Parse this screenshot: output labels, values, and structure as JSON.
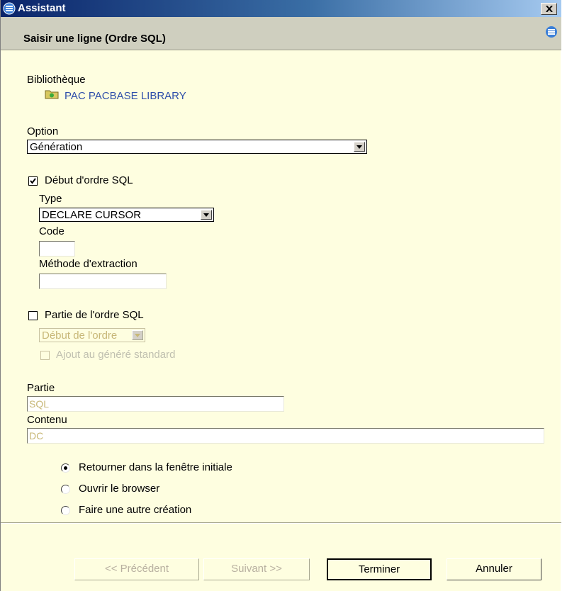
{
  "window": {
    "title": "Assistant"
  },
  "header": {
    "title": "Saisir une ligne (Ordre SQL)"
  },
  "library": {
    "label": "Bibliothèque",
    "name": "PAC PACBASE LIBRARY"
  },
  "option": {
    "label": "Option",
    "value": "Génération"
  },
  "debut": {
    "label": "Début d'ordre SQL",
    "checked": true,
    "type_label": "Type",
    "type_value": "DECLARE CURSOR",
    "code_label": "Code",
    "code_value": "",
    "methode_label": "Méthode d'extraction",
    "methode_value": ""
  },
  "partie_ordre": {
    "label": "Partie de l'ordre SQL",
    "checked": false,
    "combo_value": "Début de l'ordre",
    "ajout_label": "Ajout au généré standard"
  },
  "partie": {
    "label": "Partie",
    "value": "SQL"
  },
  "contenu": {
    "label": "Contenu",
    "value": "DC"
  },
  "radios": [
    {
      "label": "Retourner dans la fenêtre initiale",
      "selected": true
    },
    {
      "label": "Ouvrir le browser",
      "selected": false
    },
    {
      "label": "Faire une autre création",
      "selected": false
    }
  ],
  "buttons": {
    "precedent": "<< Précédent",
    "suivant": "Suivant >>",
    "terminer": "Terminer",
    "annuler": "Annuler"
  },
  "colors": {
    "title_gradient_start": "#0a246a",
    "background": "#fefee0",
    "header": "#cfcfbf",
    "link": "#2f4faa"
  }
}
